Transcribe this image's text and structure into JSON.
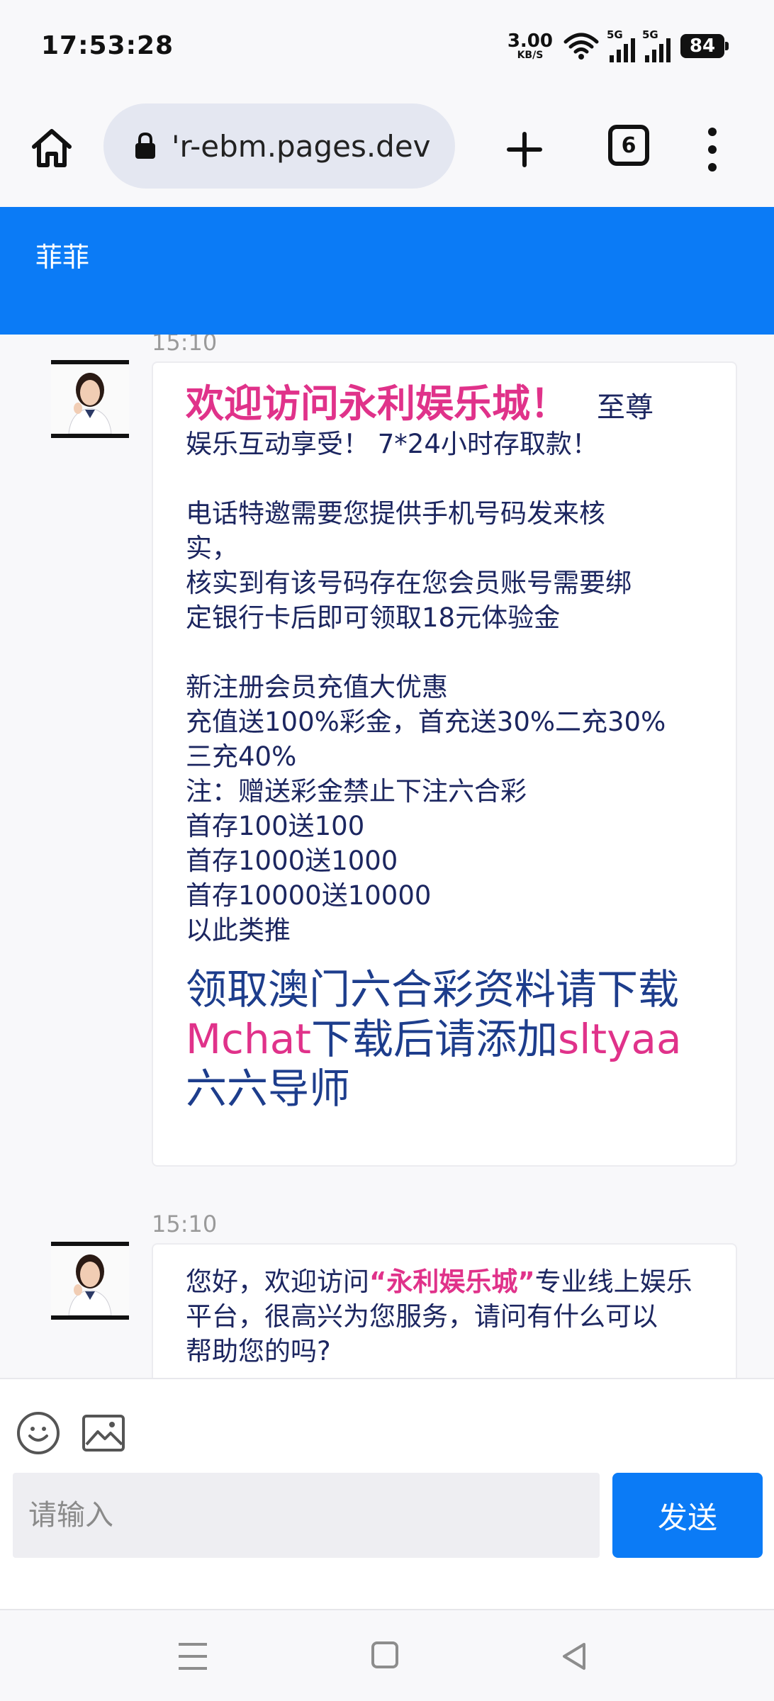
{
  "status": {
    "time": "17:53:28",
    "net_speed_value": "3.00",
    "net_speed_unit": "KB/S",
    "sim1_label": "5G",
    "sim2_label": "5G",
    "battery": "84"
  },
  "browser": {
    "url": "'r-ebm.pages.dev",
    "tab_count": "6"
  },
  "chat": {
    "title": "菲菲",
    "messages": [
      {
        "time": "15:10",
        "welcome": "欢迎访问永利娱乐城！",
        "welcome_tail": "至尊",
        "lines_1": [
          "娱乐互动享受！ 7*24小时存取款！"
        ],
        "lines_2": [
          "电话特邀需要您提供手机号码发来核",
          "实，",
          "核实到有该号码存在您会员账号需要绑",
          "定银行卡后即可领取18元体验金"
        ],
        "lines_3": [
          "新注册会员充值大优惠",
          "充值送100%彩金，首充送30%二充30%",
          "三充40%",
          "注：赠送彩金禁止下注六合彩",
          "首存100送100",
          "首存1000送1000",
          "首存10000送10000",
          "以此类推"
        ],
        "big_1": "领取澳门六合彩资料请下载",
        "big_2_app": "Mchat",
        "big_2_mid": "下载后请添加",
        "big_2_id": "sltyaa",
        "big_3": "六六导师"
      },
      {
        "time": "15:10",
        "line1_pre": "您好，欢迎访问",
        "line1_brand": "“永利娱乐城”",
        "line1_post": "专业线上娱乐",
        "line2": "平台，很高兴为您服务，请问有什么可以",
        "line3": "帮助您的吗?"
      }
    ]
  },
  "input": {
    "placeholder": "请输入",
    "send_label": "发送"
  },
  "colors": {
    "accent": "#0b7bf6",
    "highlight": "#e0328a",
    "text": "#1c2660"
  }
}
